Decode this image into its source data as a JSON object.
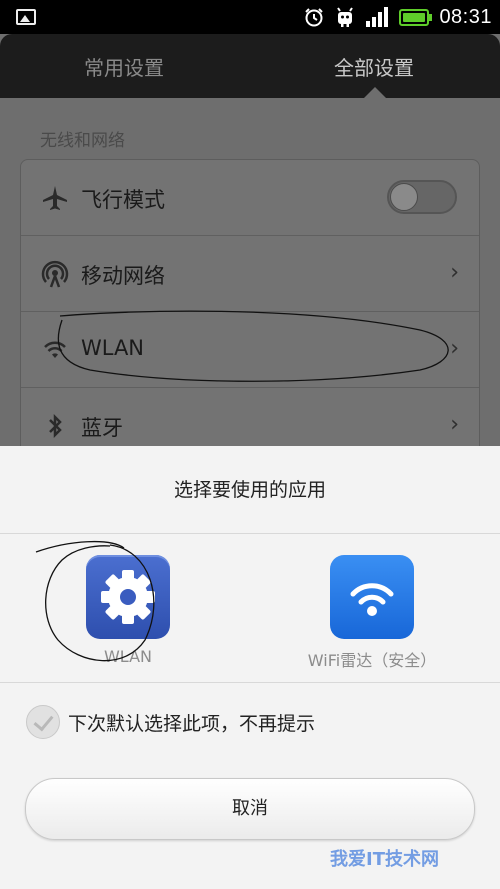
{
  "status_bar": {
    "time": "08:31"
  },
  "settings_screen": {
    "tabs": [
      {
        "label": "常用设置"
      },
      {
        "label": "全部设置"
      }
    ],
    "section_title": "无线和网络",
    "rows": [
      {
        "label": "飞行模式",
        "icon": "airplane-icon",
        "type": "toggle"
      },
      {
        "label": "移动网络",
        "icon": "cellular-icon",
        "type": "chevron"
      },
      {
        "label": "WLAN",
        "icon": "wifi-icon",
        "type": "chevron"
      },
      {
        "label": "蓝牙",
        "icon": "bluetooth-icon",
        "type": "chevron"
      }
    ],
    "chevron": "›"
  },
  "chooser_dialog": {
    "title": "选择要使用的应用",
    "apps": [
      {
        "label": "WLAN",
        "icon": "settings-gear-icon"
      },
      {
        "label": "WiFi雷达（安全）",
        "icon": "wifi-radar-icon"
      }
    ],
    "remember_label": "下次默认选择此项，不再提示",
    "cancel_label": "取消"
  },
  "watermark": {
    "text": "我爱IT技术网"
  },
  "colors": {
    "dialog_bg": "#f3f3f3",
    "dim_bg": "#6e6e6e",
    "battery": "#5fce2a",
    "wifi_app": "#1867d8",
    "settings_app": "#2e4fae"
  }
}
